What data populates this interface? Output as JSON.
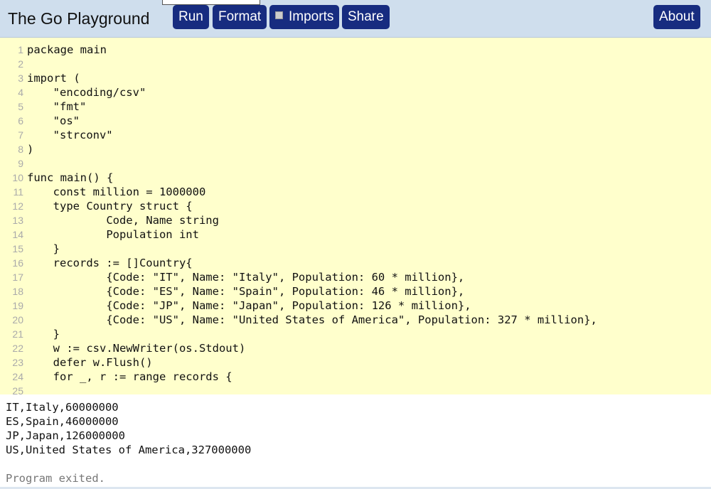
{
  "header": {
    "title": "The Go Playground",
    "buttons": {
      "run": "Run",
      "format": "Format",
      "imports": "Imports",
      "share": "Share",
      "about": "About"
    },
    "imports_checked": false,
    "button_color": "#172c80"
  },
  "editor": {
    "lines": [
      "package main",
      "",
      "import (",
      "\t\"encoding/csv\"",
      "\t\"fmt\"",
      "\t\"os\"",
      "\t\"strconv\"",
      ")",
      "",
      "func main() {",
      "\tconst million = 1000000",
      "\ttype Country struct {",
      "\t\tCode, Name string",
      "\t\tPopulation int",
      "\t}",
      "\trecords := []Country{",
      "\t\t{Code: \"IT\", Name: \"Italy\", Population: 60 * million},",
      "\t\t{Code: \"ES\", Name: \"Spain\", Population: 46 * million},",
      "\t\t{Code: \"JP\", Name: \"Japan\", Population: 126 * million},",
      "\t\t{Code: \"US\", Name: \"United States of America\", Population: 327 * million},",
      "\t}",
      "\tw := csv.NewWriter(os.Stdout)",
      "\tdefer w.Flush()",
      "\tfor _, r := range records {",
      ""
    ]
  },
  "output": {
    "lines": [
      "IT,Italy,60000000",
      "ES,Spain,46000000",
      "JP,Japan,126000000",
      "US,United States of America,327000000"
    ],
    "status": "Program exited."
  }
}
